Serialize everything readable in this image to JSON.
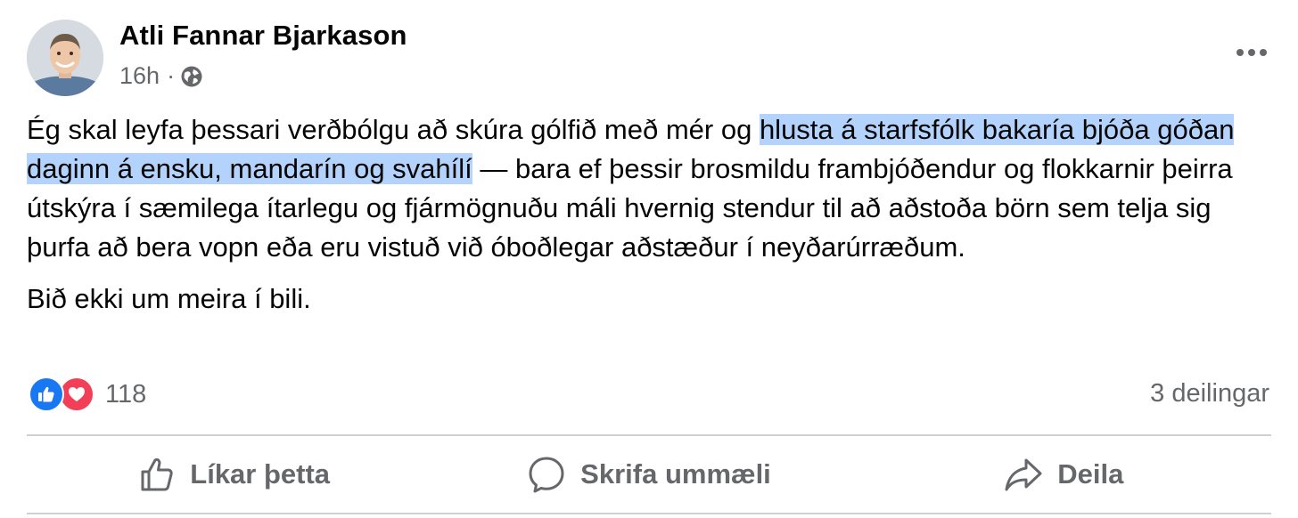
{
  "post": {
    "author": "Atli Fannar Bjarkason",
    "time": "16h",
    "separator": "·",
    "audience_icon": "globe-icon",
    "paragraph1_before": "Ég skal leyfa þessari verðbólgu að skúra gólfið með mér og ",
    "paragraph1_highlight": "hlusta á starfsfólk bakaría bjóða góðan daginn á ensku, mandarín og svahílí",
    "paragraph1_after": " — bara ef þessir brosmildu frambjóðendur og flokkarnir þeirra útskýra í sæmilega ítarlegu og fjármögnuðu máli hvernig stendur til að aðstoða börn sem telja sig þurfa að bera vopn eða eru vistuð við óboðlegar aðstæður í neyðarúrræðum.",
    "paragraph2": "Bið ekki um meira í bili."
  },
  "stats": {
    "reaction_count": "118",
    "shares": "3 deilingar"
  },
  "actions": {
    "like": "Líkar þetta",
    "comment": "Skrifa ummæli",
    "share": "Deila"
  },
  "colors": {
    "highlight": "#b3d3fd",
    "like_blue": "#1877f2",
    "love_red": "#f33e58",
    "secondary_text": "#65676b"
  }
}
